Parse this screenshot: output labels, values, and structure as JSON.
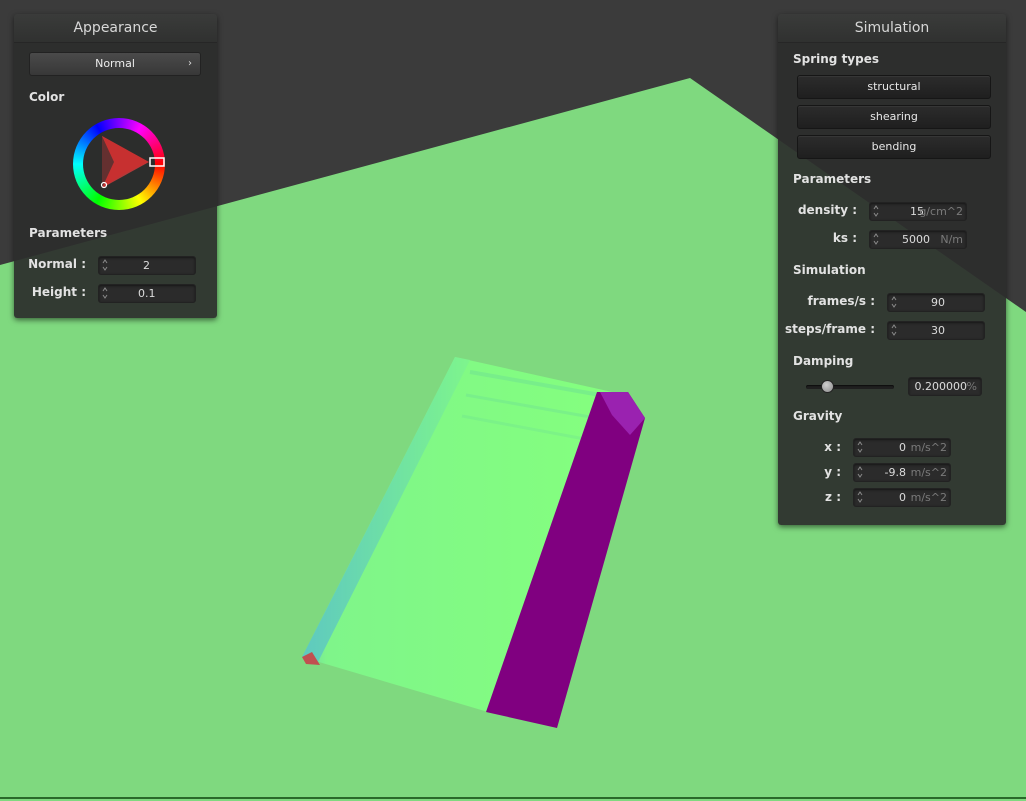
{
  "appearance": {
    "title": "Appearance",
    "shader_value": "Normal",
    "color_label": "Color",
    "parameters_label": "Parameters",
    "fields": [
      {
        "label": "Normal :",
        "value": "2"
      },
      {
        "label": "Height :",
        "value": "0.1"
      }
    ]
  },
  "simulation": {
    "title": "Simulation",
    "spring_types_label": "Spring types",
    "spring_buttons": [
      "structural",
      "shearing",
      "bending"
    ],
    "parameters_label": "Parameters",
    "params": [
      {
        "label": "density :",
        "value": "15",
        "unit": "g/cm^2"
      },
      {
        "label": "ks :",
        "value": "5000",
        "unit": "N/m"
      }
    ],
    "simulation_label": "Simulation",
    "sim_fields": [
      {
        "label": "frames/s :",
        "value": "90"
      },
      {
        "label": "steps/frame :",
        "value": "30"
      }
    ],
    "damping_label": "Damping",
    "damping_value": "0.200000",
    "damping_unit": "%",
    "damping_fraction": 0.2,
    "gravity_label": "Gravity",
    "gravity": [
      {
        "label": "x :",
        "value": "0",
        "unit": "m/s^2"
      },
      {
        "label": "y :",
        "value": "-9.8",
        "unit": "m/s^2"
      },
      {
        "label": "z :",
        "value": "0",
        "unit": "m/s^2"
      }
    ]
  },
  "colors": {
    "background": "#3b3b3b",
    "ground": "#7fd97f",
    "cloth_front": "#82fd82",
    "cloth_back": "#800080"
  }
}
